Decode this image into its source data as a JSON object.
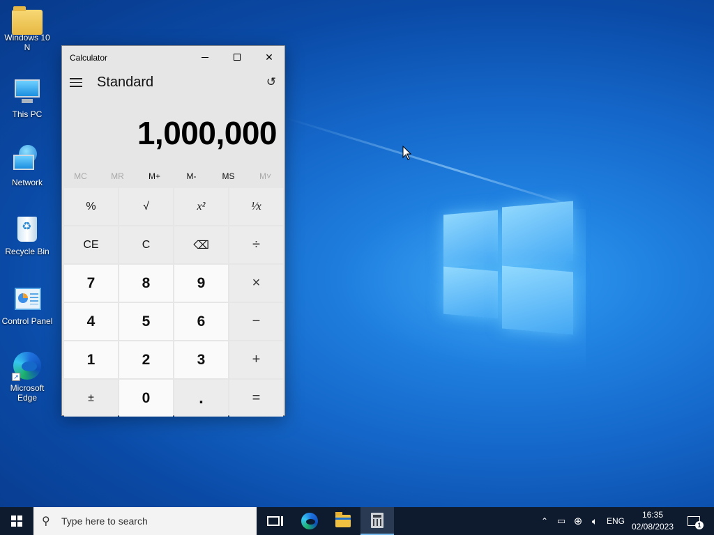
{
  "desktop": {
    "icons": [
      {
        "label": "Windows 10\nN",
        "l1": "Windows 10",
        "l2": "N"
      },
      {
        "label": "This PC"
      },
      {
        "label": "Network"
      },
      {
        "label": "Recycle Bin"
      },
      {
        "label": "Control Panel"
      },
      {
        "label": "Microsoft Edge",
        "l1": "Microsoft",
        "l2": "Edge"
      }
    ]
  },
  "calculator": {
    "title": "Calculator",
    "mode": "Standard",
    "display": "1,000,000",
    "memory": [
      {
        "label": "MC",
        "enabled": false
      },
      {
        "label": "MR",
        "enabled": false
      },
      {
        "label": "M+",
        "enabled": true
      },
      {
        "label": "M-",
        "enabled": true
      },
      {
        "label": "MS",
        "enabled": true
      },
      {
        "label": "M˅",
        "enabled": false
      }
    ],
    "keys": {
      "percent": "%",
      "sqrt": "√",
      "square": "x²",
      "reciprocal": "¹⁄x",
      "ce": "CE",
      "c": "C",
      "backspace": "⌫",
      "divide": "÷",
      "k7": "7",
      "k8": "8",
      "k9": "9",
      "multiply": "×",
      "k4": "4",
      "k5": "5",
      "k6": "6",
      "minus": "−",
      "k1": "1",
      "k2": "2",
      "k3": "3",
      "plus": "+",
      "negate": "±",
      "k0": "0",
      "decimal": ".",
      "equals": "="
    }
  },
  "taskbar": {
    "search_placeholder": "Type here to search",
    "language": "ENG",
    "time": "16:35",
    "date": "02/08/2023",
    "notification_count": "1"
  }
}
